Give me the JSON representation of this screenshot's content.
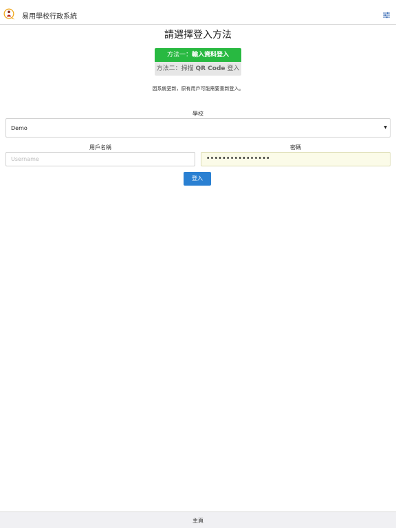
{
  "header": {
    "app_title": "易用學校行政系統",
    "logo_icon": "person-speech-bubble-icon",
    "settings_icon": "sliders-icon"
  },
  "main": {
    "heading": "請選擇登入方法",
    "methods": [
      {
        "prefix": "方法一：",
        "label": "輸入資料登入",
        "active": true
      },
      {
        "prefix": "方法二：掃描 ",
        "bold": "QR Code",
        "suffix": " 登入",
        "active": false
      }
    ],
    "notice": "因系統更新，原有用戶可能需要重新登入。",
    "school": {
      "label": "學校",
      "selected": "Demo"
    },
    "username": {
      "label": "用戶名稱",
      "placeholder": "Username",
      "value": ""
    },
    "password": {
      "label": "密碼",
      "masked_value": "••••••••••••••••"
    },
    "login_label": "登入"
  },
  "footer": {
    "home_label": "主頁"
  },
  "colors": {
    "accent_green": "#28b941",
    "button_blue": "#2a80d2",
    "logo_orange": "#f0a81e"
  }
}
